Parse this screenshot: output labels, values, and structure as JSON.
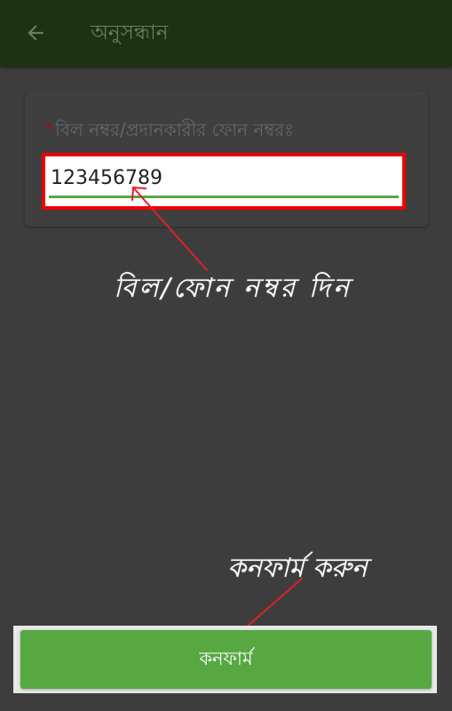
{
  "appbar": {
    "title": "অনুসন্ধান",
    "back_icon": "arrow-left-icon"
  },
  "form": {
    "required_mark": "*",
    "field_label": "বিল নম্বর/প্রদানকারীর ফোন নম্বরঃ",
    "field_value": "123456789"
  },
  "annotations": {
    "field_hint": "বিল/ফোন নম্বর দিন",
    "confirm_hint": "কনফার্ম করুন",
    "arrow_color": "#e0202a"
  },
  "confirm_button": {
    "label": "কনফার্ম"
  },
  "colors": {
    "appbar": "#1c3212",
    "background": "#3d3d3d",
    "highlight_border": "#ef0000",
    "accent_green": "#58a842"
  }
}
